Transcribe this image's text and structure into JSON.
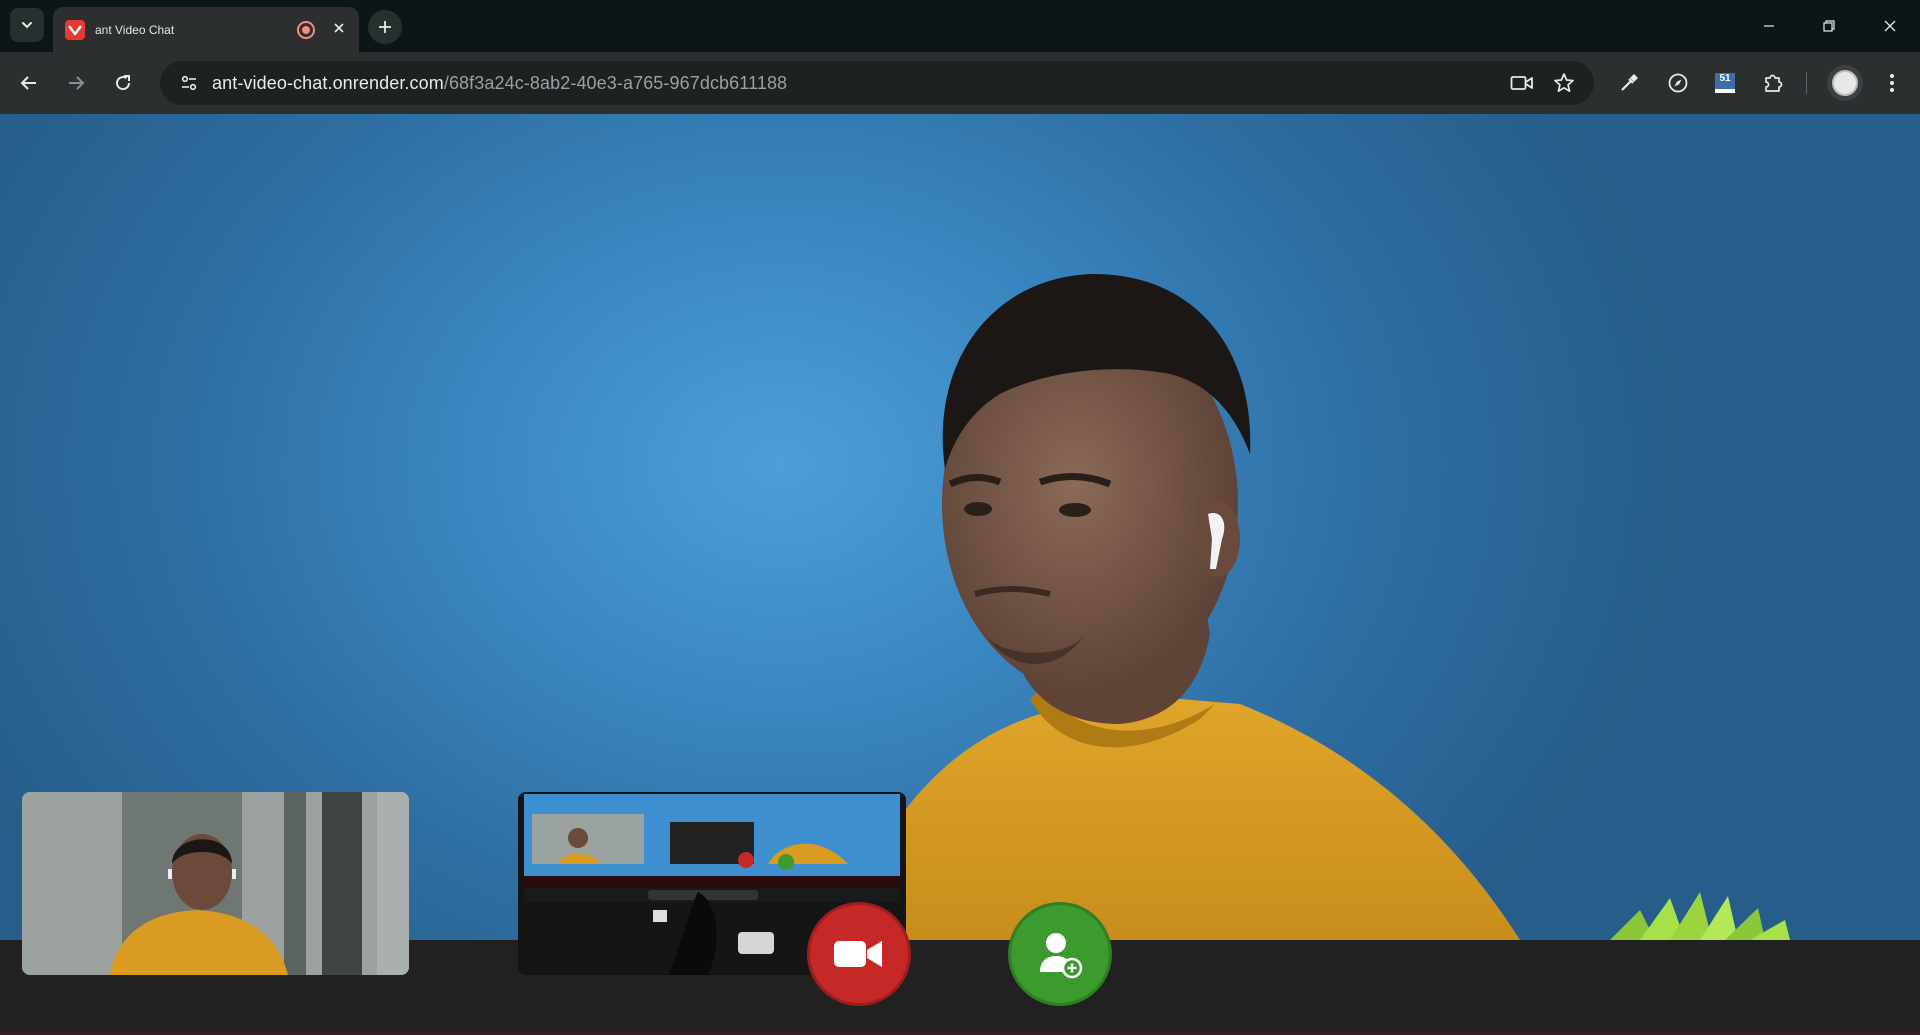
{
  "browser": {
    "tab": {
      "title": "ant Video Chat",
      "favicon": "app-logo-icon",
      "recording_indicator": "recording-icon",
      "close": "close-icon"
    },
    "address": {
      "domain": "ant-video-chat.onrender.com",
      "path": "/68f3a24c-8ab2-40e3-a765-967dcb611188"
    },
    "extension_badge": "51",
    "colors": {
      "frame": "#0c1517",
      "toolbar": "#2b2f2f",
      "omnibox": "#1d2120"
    }
  },
  "call": {
    "controls": {
      "video_button_icon": "video-camera-icon",
      "video_button_color": "#c62828",
      "add_user_button_icon": "add-user-icon",
      "add_user_button_color": "#3c9a2e"
    },
    "colors": {
      "stage_background": "#3a86c0",
      "control_bar": "#212121"
    }
  }
}
